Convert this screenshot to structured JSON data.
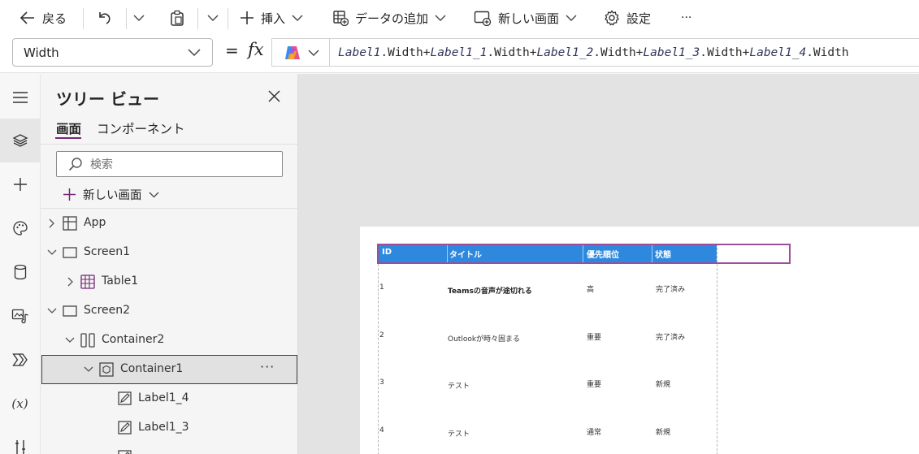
{
  "toolbar": {
    "back_label": "戻る",
    "insert_label": "挿入",
    "add_data_label": "データの追加",
    "new_screen_label": "新しい画面",
    "settings_label": "設定",
    "more_label": "···"
  },
  "formula_bar": {
    "property": "Width",
    "equals": "=",
    "fx": "fx",
    "formula": [
      {
        "ctl": "Label1",
        "prop": ".Width+"
      },
      {
        "ctl": "Label1_1",
        "prop": ".Width+"
      },
      {
        "ctl": "Label1_2",
        "prop": ".Width+"
      },
      {
        "ctl": "Label1_3",
        "prop": ".Width+"
      },
      {
        "ctl": "Label1_4",
        "prop": ".Width"
      }
    ]
  },
  "tree_view": {
    "title": "ツリー ビュー",
    "tabs": [
      "画面",
      "コンポーネント"
    ],
    "search_placeholder": "検索",
    "new_screen_label": "新しい画面",
    "nodes": [
      {
        "label": "App",
        "icon": "app-icon",
        "expanded": false,
        "depth": 0
      },
      {
        "label": "Screen1",
        "icon": "screen-icon",
        "expanded": true,
        "depth": 0
      },
      {
        "label": "Table1",
        "icon": "table-icon",
        "expanded": false,
        "depth": 1
      },
      {
        "label": "Screen2",
        "icon": "screen-icon",
        "expanded": true,
        "depth": 0
      },
      {
        "label": "Container2",
        "icon": "horizontal-container-icon",
        "expanded": true,
        "depth": 1
      },
      {
        "label": "Container1",
        "icon": "container-icon",
        "expanded": true,
        "depth": 2,
        "selected": true
      },
      {
        "label": "Label1_4",
        "icon": "label-icon",
        "depth": 3
      },
      {
        "label": "Label1_3",
        "icon": "label-icon",
        "depth": 3
      }
    ],
    "more_label": "···"
  },
  "table": {
    "headers": [
      "ID",
      "タイトル",
      "優先順位",
      "状態"
    ],
    "rows": [
      {
        "id": "1",
        "title": "Teamsの音声が途切れる",
        "priority": "高",
        "status": "完了済み"
      },
      {
        "id": "2",
        "title": "Outlookが時々固まる",
        "priority": "重要",
        "status": "完了済み"
      },
      {
        "id": "3",
        "title": "テスト",
        "priority": "重要",
        "status": "新規"
      },
      {
        "id": "4",
        "title": "テスト",
        "priority": "通常",
        "status": "新規"
      }
    ]
  },
  "colors": {
    "accent": "#742774",
    "header_fill": "#2e89de",
    "selection": "#9b4e9b"
  }
}
